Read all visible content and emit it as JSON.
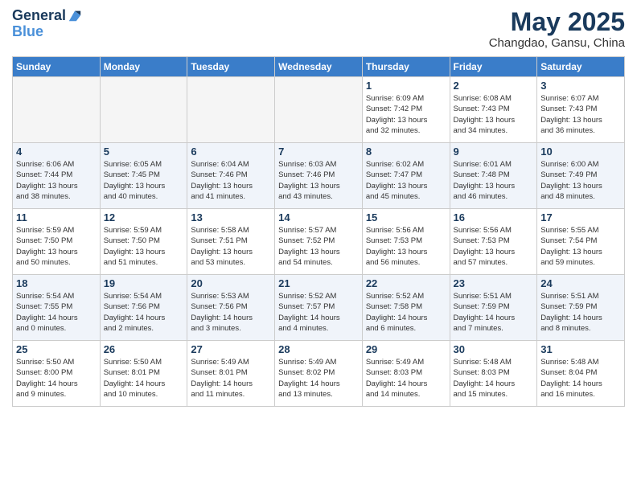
{
  "header": {
    "logo_line1": "General",
    "logo_line2": "Blue",
    "month": "May 2025",
    "location": "Changdao, Gansu, China"
  },
  "weekdays": [
    "Sunday",
    "Monday",
    "Tuesday",
    "Wednesday",
    "Thursday",
    "Friday",
    "Saturday"
  ],
  "weeks": [
    [
      {
        "day": "",
        "detail": ""
      },
      {
        "day": "",
        "detail": ""
      },
      {
        "day": "",
        "detail": ""
      },
      {
        "day": "",
        "detail": ""
      },
      {
        "day": "1",
        "detail": "Sunrise: 6:09 AM\nSunset: 7:42 PM\nDaylight: 13 hours\nand 32 minutes."
      },
      {
        "day": "2",
        "detail": "Sunrise: 6:08 AM\nSunset: 7:43 PM\nDaylight: 13 hours\nand 34 minutes."
      },
      {
        "day": "3",
        "detail": "Sunrise: 6:07 AM\nSunset: 7:43 PM\nDaylight: 13 hours\nand 36 minutes."
      }
    ],
    [
      {
        "day": "4",
        "detail": "Sunrise: 6:06 AM\nSunset: 7:44 PM\nDaylight: 13 hours\nand 38 minutes."
      },
      {
        "day": "5",
        "detail": "Sunrise: 6:05 AM\nSunset: 7:45 PM\nDaylight: 13 hours\nand 40 minutes."
      },
      {
        "day": "6",
        "detail": "Sunrise: 6:04 AM\nSunset: 7:46 PM\nDaylight: 13 hours\nand 41 minutes."
      },
      {
        "day": "7",
        "detail": "Sunrise: 6:03 AM\nSunset: 7:46 PM\nDaylight: 13 hours\nand 43 minutes."
      },
      {
        "day": "8",
        "detail": "Sunrise: 6:02 AM\nSunset: 7:47 PM\nDaylight: 13 hours\nand 45 minutes."
      },
      {
        "day": "9",
        "detail": "Sunrise: 6:01 AM\nSunset: 7:48 PM\nDaylight: 13 hours\nand 46 minutes."
      },
      {
        "day": "10",
        "detail": "Sunrise: 6:00 AM\nSunset: 7:49 PM\nDaylight: 13 hours\nand 48 minutes."
      }
    ],
    [
      {
        "day": "11",
        "detail": "Sunrise: 5:59 AM\nSunset: 7:50 PM\nDaylight: 13 hours\nand 50 minutes."
      },
      {
        "day": "12",
        "detail": "Sunrise: 5:59 AM\nSunset: 7:50 PM\nDaylight: 13 hours\nand 51 minutes."
      },
      {
        "day": "13",
        "detail": "Sunrise: 5:58 AM\nSunset: 7:51 PM\nDaylight: 13 hours\nand 53 minutes."
      },
      {
        "day": "14",
        "detail": "Sunrise: 5:57 AM\nSunset: 7:52 PM\nDaylight: 13 hours\nand 54 minutes."
      },
      {
        "day": "15",
        "detail": "Sunrise: 5:56 AM\nSunset: 7:53 PM\nDaylight: 13 hours\nand 56 minutes."
      },
      {
        "day": "16",
        "detail": "Sunrise: 5:56 AM\nSunset: 7:53 PM\nDaylight: 13 hours\nand 57 minutes."
      },
      {
        "day": "17",
        "detail": "Sunrise: 5:55 AM\nSunset: 7:54 PM\nDaylight: 13 hours\nand 59 minutes."
      }
    ],
    [
      {
        "day": "18",
        "detail": "Sunrise: 5:54 AM\nSunset: 7:55 PM\nDaylight: 14 hours\nand 0 minutes."
      },
      {
        "day": "19",
        "detail": "Sunrise: 5:54 AM\nSunset: 7:56 PM\nDaylight: 14 hours\nand 2 minutes."
      },
      {
        "day": "20",
        "detail": "Sunrise: 5:53 AM\nSunset: 7:56 PM\nDaylight: 14 hours\nand 3 minutes."
      },
      {
        "day": "21",
        "detail": "Sunrise: 5:52 AM\nSunset: 7:57 PM\nDaylight: 14 hours\nand 4 minutes."
      },
      {
        "day": "22",
        "detail": "Sunrise: 5:52 AM\nSunset: 7:58 PM\nDaylight: 14 hours\nand 6 minutes."
      },
      {
        "day": "23",
        "detail": "Sunrise: 5:51 AM\nSunset: 7:59 PM\nDaylight: 14 hours\nand 7 minutes."
      },
      {
        "day": "24",
        "detail": "Sunrise: 5:51 AM\nSunset: 7:59 PM\nDaylight: 14 hours\nand 8 minutes."
      }
    ],
    [
      {
        "day": "25",
        "detail": "Sunrise: 5:50 AM\nSunset: 8:00 PM\nDaylight: 14 hours\nand 9 minutes."
      },
      {
        "day": "26",
        "detail": "Sunrise: 5:50 AM\nSunset: 8:01 PM\nDaylight: 14 hours\nand 10 minutes."
      },
      {
        "day": "27",
        "detail": "Sunrise: 5:49 AM\nSunset: 8:01 PM\nDaylight: 14 hours\nand 11 minutes."
      },
      {
        "day": "28",
        "detail": "Sunrise: 5:49 AM\nSunset: 8:02 PM\nDaylight: 14 hours\nand 13 minutes."
      },
      {
        "day": "29",
        "detail": "Sunrise: 5:49 AM\nSunset: 8:03 PM\nDaylight: 14 hours\nand 14 minutes."
      },
      {
        "day": "30",
        "detail": "Sunrise: 5:48 AM\nSunset: 8:03 PM\nDaylight: 14 hours\nand 15 minutes."
      },
      {
        "day": "31",
        "detail": "Sunrise: 5:48 AM\nSunset: 8:04 PM\nDaylight: 14 hours\nand 16 minutes."
      }
    ]
  ]
}
